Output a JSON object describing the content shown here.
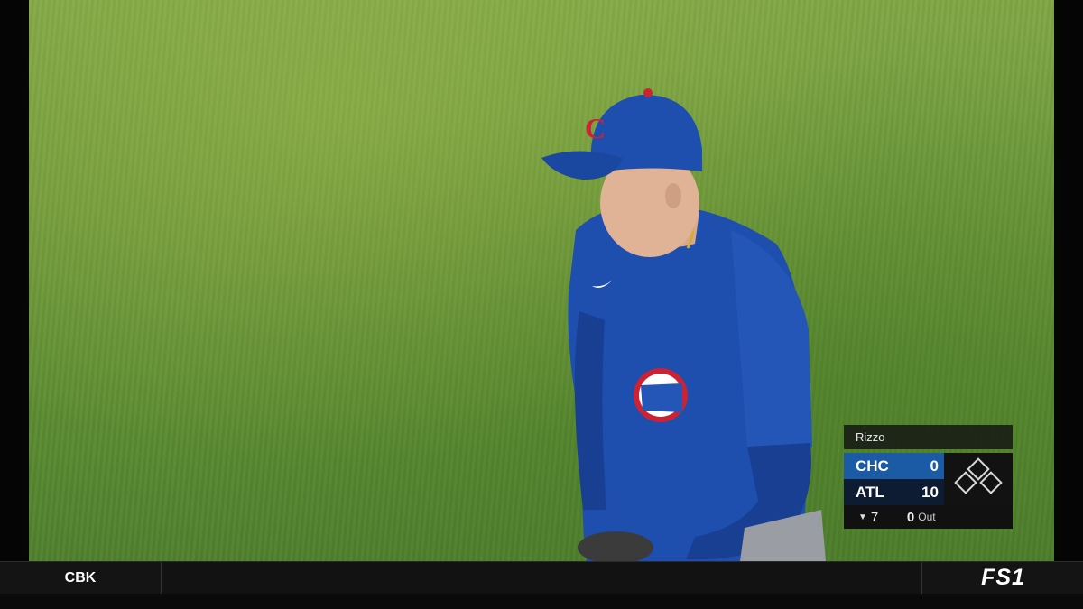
{
  "scorebug": {
    "player_name": "Rizzo",
    "teams": [
      {
        "abbr": "CHC",
        "runs": "0",
        "color": "#1b5aa5"
      },
      {
        "abbr": "ATL",
        "runs": "10",
        "color": "#0e1c33"
      }
    ],
    "inning": {
      "half_icon": "bottom-inning-arrow-icon",
      "half_glyph": "▼",
      "number": "7"
    },
    "outs": {
      "count": "0",
      "label": "Out"
    },
    "bases_occupied": {
      "first": false,
      "second": false,
      "third": false
    }
  },
  "ticker": {
    "left_label": "CBK",
    "network_logo": "FS1"
  },
  "colors": {
    "field": "#6f9a3b",
    "cubs_blue": "#1e4fae",
    "cubs_red": "#cc2233"
  }
}
